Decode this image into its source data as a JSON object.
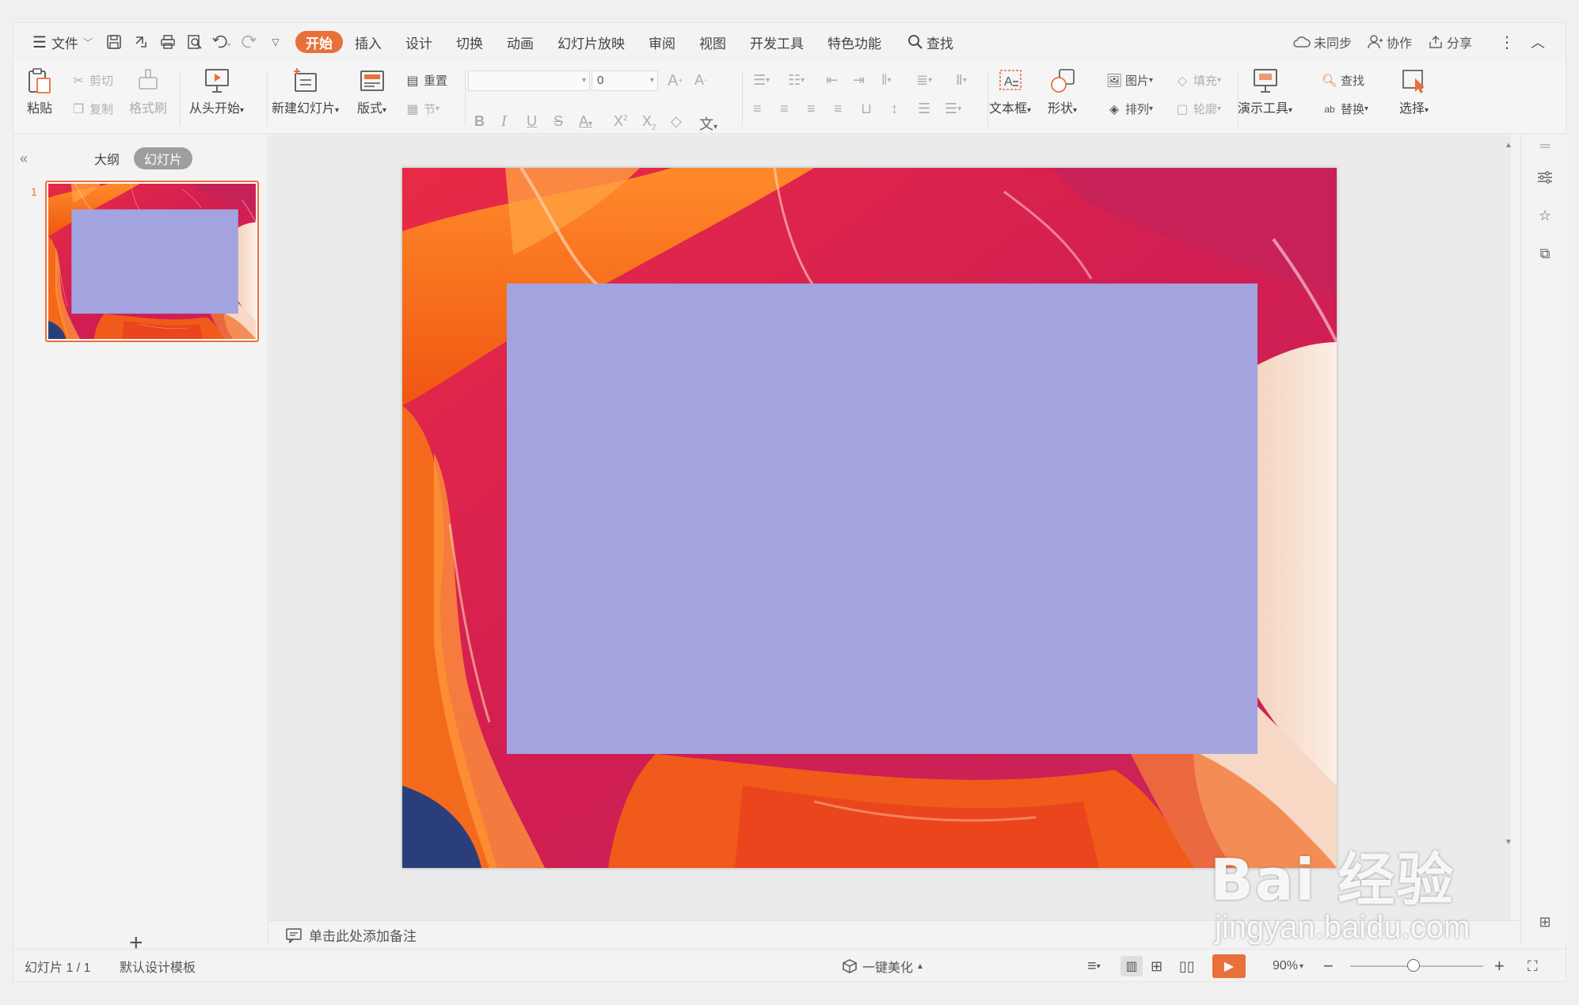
{
  "menubar": {
    "file": "文件",
    "tabs": [
      "开始",
      "插入",
      "设计",
      "切换",
      "动画",
      "幻灯片放映",
      "审阅",
      "视图",
      "开发工具",
      "特色功能"
    ],
    "search": "查找",
    "sync": "未同步",
    "collab": "协作",
    "share": "分享"
  },
  "ribbon": {
    "paste": "粘贴",
    "cut": "剪切",
    "copy": "复制",
    "format_painter": "格式刷",
    "from_start": "从头开始",
    "new_slide": "新建幻灯片",
    "layout": "版式",
    "reset": "重置",
    "section": "节",
    "font_size": "0",
    "textbox": "文本框",
    "shape": "形状",
    "picture": "图片",
    "fill": "填充",
    "arrange": "排列",
    "outline": "轮廓",
    "present_tools": "演示工具",
    "find": "查找",
    "replace": "替换",
    "select": "选择"
  },
  "leftpanel": {
    "outline_tab": "大纲",
    "slides_tab": "幻灯片",
    "slide_number": "1"
  },
  "notes": {
    "placeholder": "单击此处添加备注"
  },
  "status": {
    "slide_info": "幻灯片 1 / 1",
    "template": "默认设计模板",
    "beautify": "一键美化",
    "zoom": "90%"
  },
  "watermark": {
    "brand": "Bai 经验",
    "url": "jingyan.baidu.com"
  },
  "colors": {
    "accent": "#e8703a",
    "placeholder_box": "#a3a3df",
    "paint_red": "#d8224a",
    "paint_orange": "#f06a1a"
  }
}
